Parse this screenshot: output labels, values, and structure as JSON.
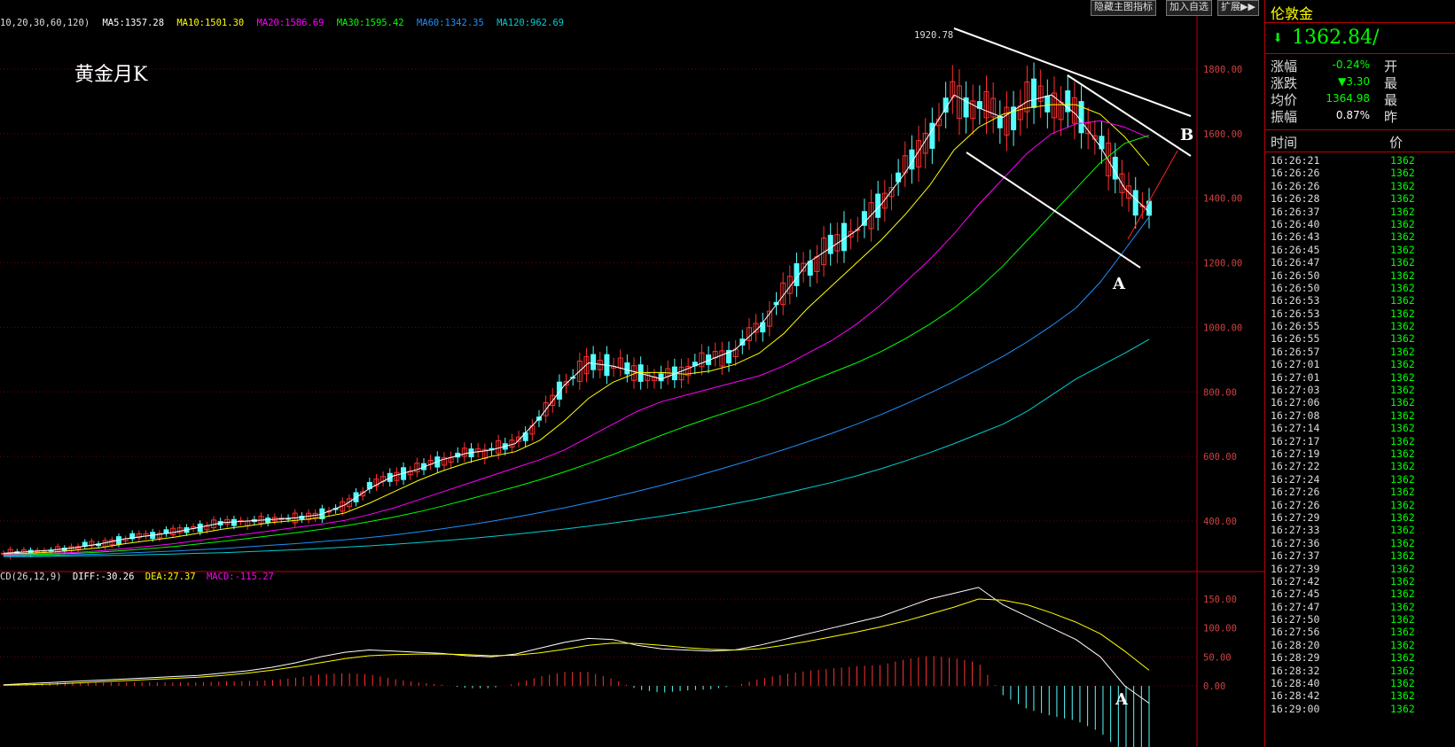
{
  "ma_header": {
    "prefix": "10,20,30,60,120)",
    "ma5": "MA5:1357.28",
    "ma10": "MA10:1501.30",
    "ma20": "MA20:1586.69",
    "ma30": "MA30:1595.42",
    "ma60": "MA60:1342.35",
    "ma120": "MA120:962.69"
  },
  "macd_header": {
    "prefix": "CD(26,12,9)",
    "diff": "DIFF:-30.26",
    "dea": "DEA:27.37",
    "macd": "MACD:-115.27"
  },
  "chart_title": "黄金月K",
  "peak_label": "1920.78",
  "annotations": {
    "a_upper": "A",
    "b": "B",
    "a_lower": "A"
  },
  "toolbar": {
    "hide_indicator": "隐藏主图指标",
    "add_watch": "加入自选",
    "expand": "扩展▶▶"
  },
  "colors": {
    "up": "#ff3030",
    "down": "#54ffff",
    "ma5": "#ffffff",
    "ma10": "#ffff00",
    "ma20": "#ff00ff",
    "ma30": "#00ff00",
    "ma60": "#1e90ff",
    "ma120": "#00ced1",
    "grid": "#7a0000",
    "text_green": "#00ff00"
  },
  "chart_data": [
    {
      "type": "line",
      "title": "黄金月K",
      "ylabel": "",
      "ylim": [
        280,
        1940
      ],
      "y_ticks": [
        "1800.00",
        "1600.00",
        "1400.00",
        "1200.00",
        "1000.00",
        "800.00",
        "600.00",
        "400.00"
      ],
      "peak": 1920.78,
      "series": [
        {
          "name": "MA5",
          "values": [
            300,
            305,
            310,
            318,
            330,
            345,
            355,
            365,
            380,
            395,
            400,
            405,
            410,
            420,
            450,
            500,
            540,
            560,
            590,
            610,
            620,
            640,
            720,
            820,
            890,
            880,
            860,
            840,
            870,
            900,
            930,
            1000,
            1100,
            1200,
            1250,
            1300,
            1380,
            1480,
            1600,
            1720,
            1680,
            1650,
            1700,
            1720,
            1660,
            1560,
            1430,
            1357
          ]
        },
        {
          "name": "MA10",
          "values": [
            298,
            300,
            304,
            310,
            318,
            330,
            340,
            350,
            362,
            375,
            385,
            395,
            402,
            410,
            425,
            455,
            490,
            525,
            555,
            580,
            600,
            615,
            650,
            710,
            780,
            830,
            860,
            860,
            855,
            865,
            885,
            920,
            980,
            1060,
            1130,
            1200,
            1270,
            1350,
            1440,
            1550,
            1620,
            1660,
            1680,
            1690,
            1690,
            1660,
            1590,
            1501
          ]
        },
        {
          "name": "MA20",
          "values": [
            296,
            298,
            300,
            303,
            308,
            315,
            322,
            330,
            340,
            350,
            360,
            370,
            380,
            390,
            402,
            420,
            440,
            465,
            490,
            515,
            540,
            565,
            590,
            620,
            660,
            700,
            740,
            770,
            790,
            810,
            830,
            850,
            880,
            920,
            960,
            1010,
            1070,
            1140,
            1210,
            1290,
            1380,
            1460,
            1540,
            1600,
            1630,
            1640,
            1620,
            1587
          ]
        },
        {
          "name": "MA30",
          "values": [
            294,
            296,
            298,
            300,
            304,
            309,
            315,
            321,
            329,
            337,
            346,
            355,
            364,
            374,
            385,
            398,
            412,
            428,
            446,
            466,
            486,
            506,
            528,
            552,
            578,
            606,
            636,
            666,
            694,
            720,
            745,
            770,
            800,
            830,
            860,
            890,
            925,
            965,
            1010,
            1060,
            1120,
            1190,
            1270,
            1350,
            1430,
            1510,
            1570,
            1595
          ]
        },
        {
          "name": "MA60",
          "values": [
            292,
            293,
            294,
            296,
            298,
            301,
            304,
            307,
            311,
            315,
            320,
            325,
            330,
            336,
            342,
            349,
            357,
            366,
            376,
            387,
            399,
            412,
            426,
            441,
            457,
            474,
            492,
            511,
            531,
            552,
            574,
            597,
            621,
            646,
            672,
            700,
            730,
            762,
            796,
            832,
            870,
            910,
            955,
            1005,
            1060,
            1140,
            1240,
            1342
          ]
        },
        {
          "name": "MA120",
          "values": [
            290,
            290,
            291,
            292,
            293,
            294,
            296,
            298,
            300,
            302,
            305,
            308,
            311,
            315,
            319,
            323,
            328,
            333,
            339,
            345,
            352,
            359,
            367,
            375,
            384,
            394,
            404,
            415,
            427,
            440,
            454,
            469,
            485,
            502,
            520,
            540,
            562,
            586,
            612,
            640,
            670,
            700,
            740,
            790,
            840,
            880,
            920,
            963
          ]
        }
      ]
    },
    {
      "type": "line",
      "title": "",
      "ylim": [
        -90,
        195
      ],
      "y_ticks": [
        "150.00",
        "100.00",
        "50.00",
        "0.00"
      ],
      "series": [
        {
          "name": "DIFF",
          "values": [
            2,
            4,
            6,
            8,
            10,
            12,
            14,
            16,
            18,
            22,
            26,
            32,
            40,
            50,
            58,
            62,
            60,
            58,
            56,
            52,
            50,
            55,
            65,
            75,
            82,
            80,
            70,
            64,
            62,
            60,
            62,
            70,
            80,
            90,
            100,
            110,
            120,
            135,
            150,
            160,
            170,
            140,
            120,
            100,
            80,
            50,
            0,
            -30
          ]
        },
        {
          "name": "DEA",
          "values": [
            1,
            2,
            3,
            5,
            7,
            9,
            11,
            13,
            15,
            18,
            22,
            27,
            33,
            40,
            47,
            52,
            54,
            55,
            55,
            54,
            52,
            53,
            57,
            63,
            70,
            74,
            73,
            70,
            66,
            63,
            62,
            64,
            70,
            77,
            85,
            93,
            102,
            112,
            124,
            136,
            150,
            148,
            140,
            126,
            110,
            90,
            60,
            27
          ]
        },
        {
          "name": "MACD",
          "values": [
            2,
            4,
            6,
            6,
            6,
            6,
            6,
            6,
            6,
            8,
            8,
            10,
            14,
            20,
            22,
            20,
            12,
            6,
            2,
            -4,
            -4,
            4,
            16,
            24,
            24,
            12,
            -6,
            -12,
            -8,
            -6,
            0,
            12,
            20,
            26,
            30,
            34,
            36,
            46,
            52,
            48,
            40,
            -16,
            -40,
            -52,
            -60,
            -80,
            -120,
            -115
          ]
        }
      ]
    }
  ],
  "right_panel": {
    "title": "伦敦金",
    "arrow": "⬇",
    "price": "1362.84/",
    "rows": [
      {
        "label": "涨幅",
        "value": "-0.24%",
        "ext": "开"
      },
      {
        "label": "涨跌",
        "value": "▼3.30",
        "ext": "最"
      },
      {
        "label": "均价",
        "value": "1364.98",
        "ext": "最"
      },
      {
        "label": "振幅",
        "value": "0.87%",
        "ext": "昨"
      }
    ],
    "col_time": "时间",
    "col_price": "价",
    "ticks": [
      {
        "t": "16:26:21",
        "p": "1362"
      },
      {
        "t": "16:26:26",
        "p": "1362"
      },
      {
        "t": "16:26:26",
        "p": "1362"
      },
      {
        "t": "16:26:28",
        "p": "1362"
      },
      {
        "t": "16:26:37",
        "p": "1362"
      },
      {
        "t": "16:26:40",
        "p": "1362"
      },
      {
        "t": "16:26:43",
        "p": "1362"
      },
      {
        "t": "16:26:45",
        "p": "1362"
      },
      {
        "t": "16:26:47",
        "p": "1362"
      },
      {
        "t": "16:26:50",
        "p": "1362"
      },
      {
        "t": "16:26:50",
        "p": "1362"
      },
      {
        "t": "16:26:53",
        "p": "1362"
      },
      {
        "t": "16:26:53",
        "p": "1362"
      },
      {
        "t": "16:26:55",
        "p": "1362"
      },
      {
        "t": "16:26:55",
        "p": "1362"
      },
      {
        "t": "16:26:57",
        "p": "1362"
      },
      {
        "t": "16:27:01",
        "p": "1362"
      },
      {
        "t": "16:27:01",
        "p": "1362"
      },
      {
        "t": "16:27:03",
        "p": "1362"
      },
      {
        "t": "16:27:06",
        "p": "1362"
      },
      {
        "t": "16:27:08",
        "p": "1362"
      },
      {
        "t": "16:27:14",
        "p": "1362"
      },
      {
        "t": "16:27:17",
        "p": "1362"
      },
      {
        "t": "16:27:19",
        "p": "1362"
      },
      {
        "t": "16:27:22",
        "p": "1362"
      },
      {
        "t": "16:27:24",
        "p": "1362"
      },
      {
        "t": "16:27:26",
        "p": "1362"
      },
      {
        "t": "16:27:26",
        "p": "1362"
      },
      {
        "t": "16:27:29",
        "p": "1362"
      },
      {
        "t": "16:27:33",
        "p": "1362"
      },
      {
        "t": "16:27:36",
        "p": "1362"
      },
      {
        "t": "16:27:37",
        "p": "1362"
      },
      {
        "t": "16:27:39",
        "p": "1362"
      },
      {
        "t": "16:27:42",
        "p": "1362"
      },
      {
        "t": "16:27:45",
        "p": "1362"
      },
      {
        "t": "16:27:47",
        "p": "1362"
      },
      {
        "t": "16:27:50",
        "p": "1362"
      },
      {
        "t": "16:27:56",
        "p": "1362"
      },
      {
        "t": "16:28:20",
        "p": "1362"
      },
      {
        "t": "16:28:29",
        "p": "1362"
      },
      {
        "t": "16:28:32",
        "p": "1362"
      },
      {
        "t": "16:28:40",
        "p": "1362"
      },
      {
        "t": "16:28:42",
        "p": "1362"
      },
      {
        "t": "16:29:00",
        "p": "1362"
      }
    ]
  }
}
